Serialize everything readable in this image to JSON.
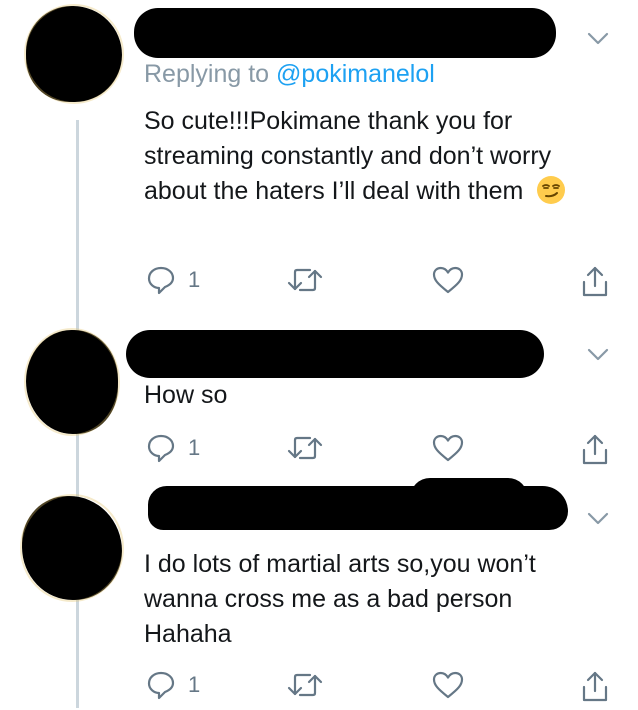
{
  "thread": [
    {
      "replying_label": "Replying to",
      "replying_handle": "@pokimanelol",
      "text": "So cute!!!Pokimane thank you for streaming constantly and don’t worry about the haters I’ll deal with them",
      "emoji": "smirk-emoji",
      "reply_count": "1"
    },
    {
      "text": "How so",
      "reply_count": "1"
    },
    {
      "text": "I do lots of martial arts so,you won’t wanna cross me as a bad person Hahaha",
      "reply_count": "1"
    }
  ],
  "icons": {
    "reply": "comment-bubble-icon",
    "retweet": "retweet-icon",
    "like": "heart-icon",
    "share": "share-icon",
    "more": "chevron-down-icon"
  },
  "colors": {
    "text": "#14171a",
    "secondary": "#657786",
    "muted": "#8899a6",
    "link": "#1da1f2",
    "thread_line": "#ccd6dd",
    "redaction": "#000000"
  }
}
